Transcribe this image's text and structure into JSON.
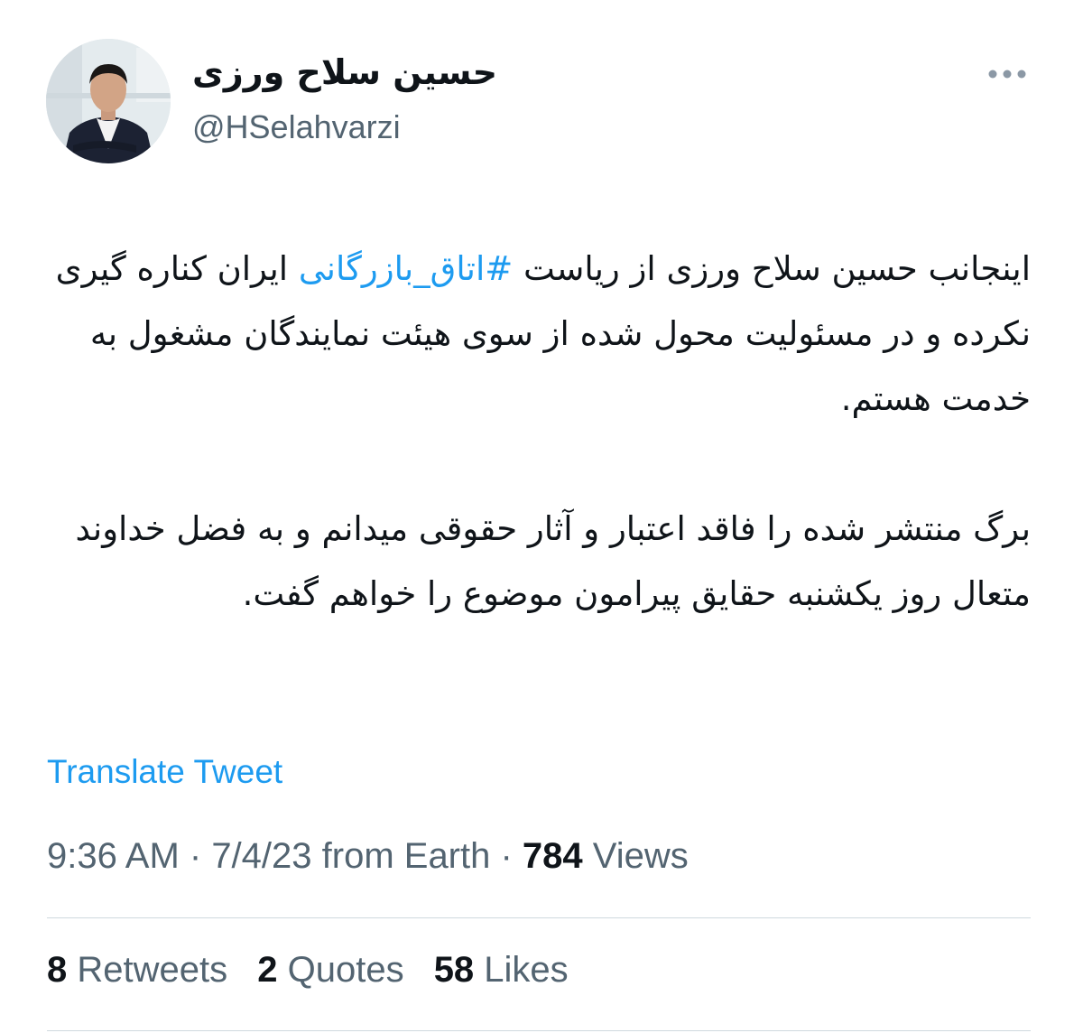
{
  "author": {
    "display_name": "حسین سلاح ورزی",
    "handle": "@HSelahvarzi"
  },
  "more_icon": "more-dots-icon",
  "tweet": {
    "para1_before": "اینجانب حسین سلاح ورزی از ریاست ",
    "hashtag": "#اتاق_بازرگانی",
    "para1_after": " ایران کناره گیری نکرده و در مسئولیت محول شده از سوی هیئت نمایندگان مشغول به خدمت هستم.",
    "para2": "برگ منتشر شده را فاقد اعتبار و آثار حقوقی میدانم و به فضل خداوند متعال روز یکشنبه حقایق پیرامون موضوع را خواهم گفت."
  },
  "translate_label": "Translate Tweet",
  "meta": {
    "time": "9:36 AM",
    "sep1": " · ",
    "date": "7/4/23",
    "source": " from Earth",
    "sep2": " · ",
    "views_count": "784",
    "views_label": " Views"
  },
  "stats": {
    "retweets_count": "8",
    "retweets_label": " Retweets",
    "quotes_count": "2",
    "quotes_label": " Quotes",
    "likes_count": "58",
    "likes_label": " Likes"
  },
  "colors": {
    "link": "#1d9bf0",
    "text": "#0f1419",
    "secondary": "#536471",
    "divider": "#cfd9de"
  }
}
